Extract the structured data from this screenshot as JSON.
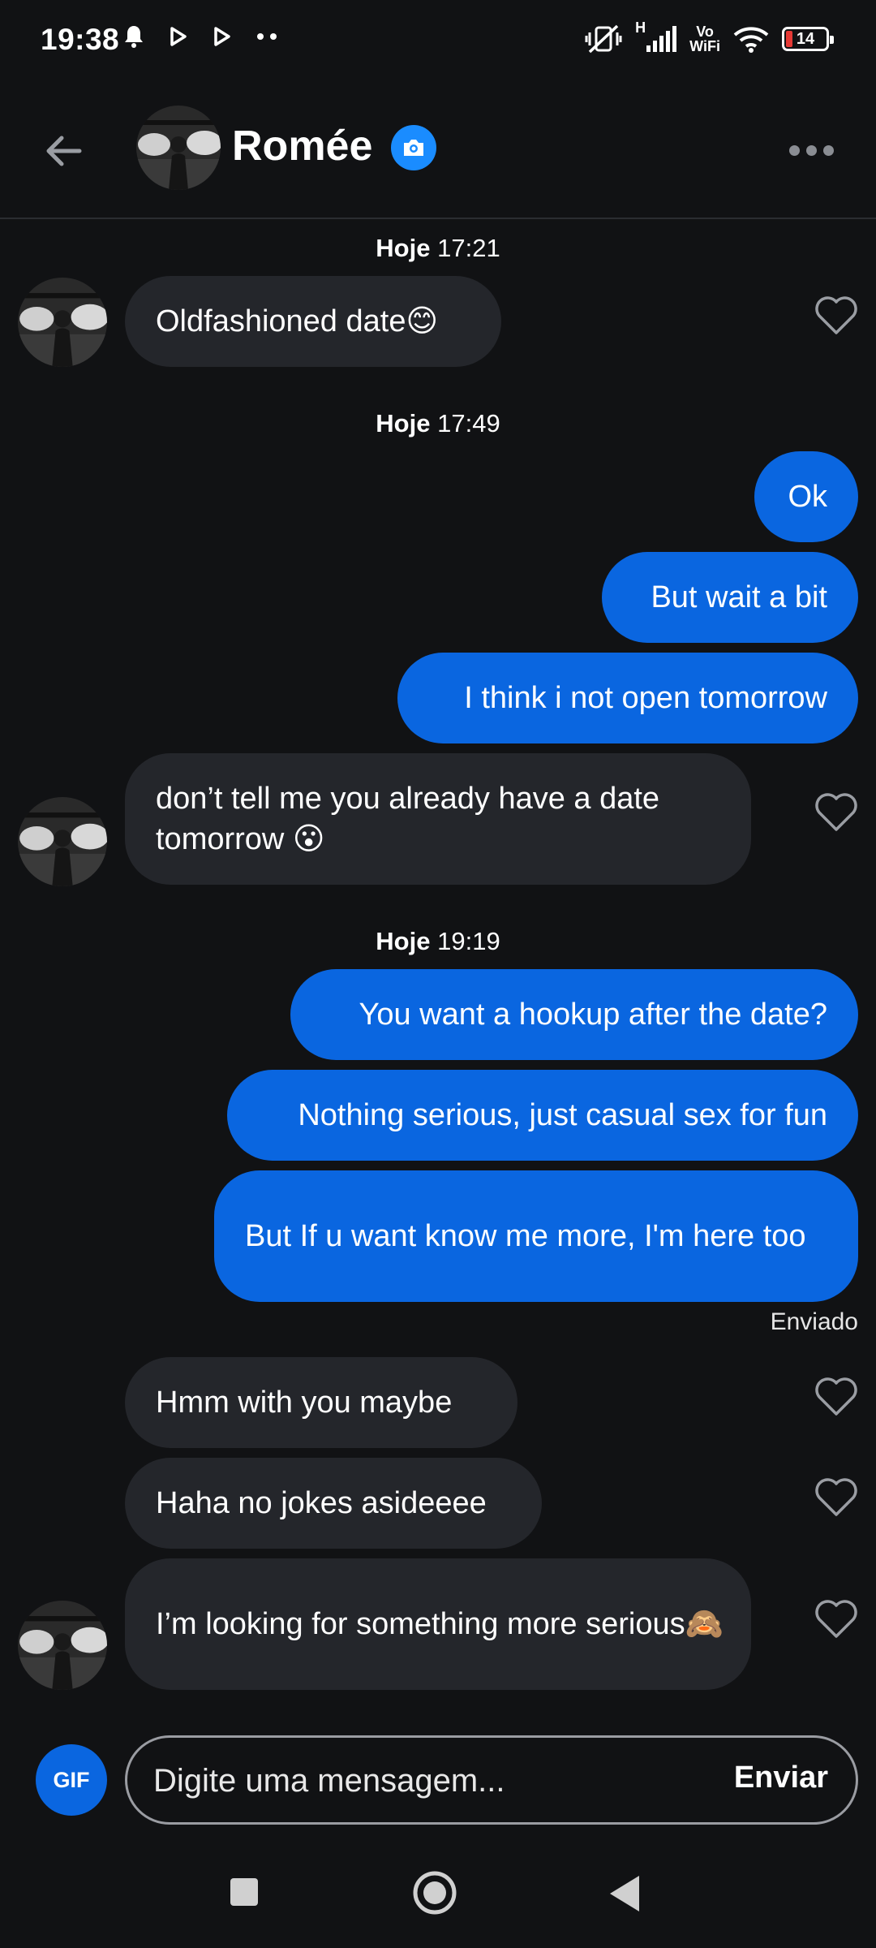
{
  "status_bar": {
    "time": "19:38",
    "battery_level": "14",
    "network": "H",
    "volte_top": "Vo",
    "volte_bottom": "WiFi"
  },
  "header": {
    "contact_name": "Romée",
    "back_icon": "arrow-left-icon",
    "verified_icon": "camera-icon",
    "more_icon": "more-horizontal-icon"
  },
  "chat": {
    "time_labels": [
      {
        "day": "Hoje",
        "time": "17:21"
      },
      {
        "day": "Hoje",
        "time": "17:49"
      },
      {
        "day": "Hoje",
        "time": "19:19"
      }
    ],
    "messages": [
      {
        "from": "them",
        "text": "Oldfashioned date😊"
      },
      {
        "from": "me",
        "text": "Ok"
      },
      {
        "from": "me",
        "text": "But wait a bit"
      },
      {
        "from": "me",
        "text": "I think i not open tomorrow"
      },
      {
        "from": "them",
        "text": "don’t tell me you already have a date tomorrow 😮"
      },
      {
        "from": "me",
        "text": "You want a hookup after the date?"
      },
      {
        "from": "me",
        "text": "Nothing serious, just casual sex for fun"
      },
      {
        "from": "me",
        "text": "But If u want know me more, I'm here too"
      },
      {
        "from": "them",
        "text": "Hmm with you maybe"
      },
      {
        "from": "them",
        "text": "Haha no jokes asideeee"
      },
      {
        "from": "them",
        "text": "I’m looking for something more serious🙈"
      }
    ],
    "sent_status": "Enviado"
  },
  "composer": {
    "gif_label": "GIF",
    "placeholder": "Digite uma mensagem...",
    "send_label": "Enviar"
  },
  "colors": {
    "background": "#111214",
    "incoming_bubble": "#24262b",
    "outgoing_bubble": "#0a66e0",
    "accent": "#1a8cff"
  }
}
